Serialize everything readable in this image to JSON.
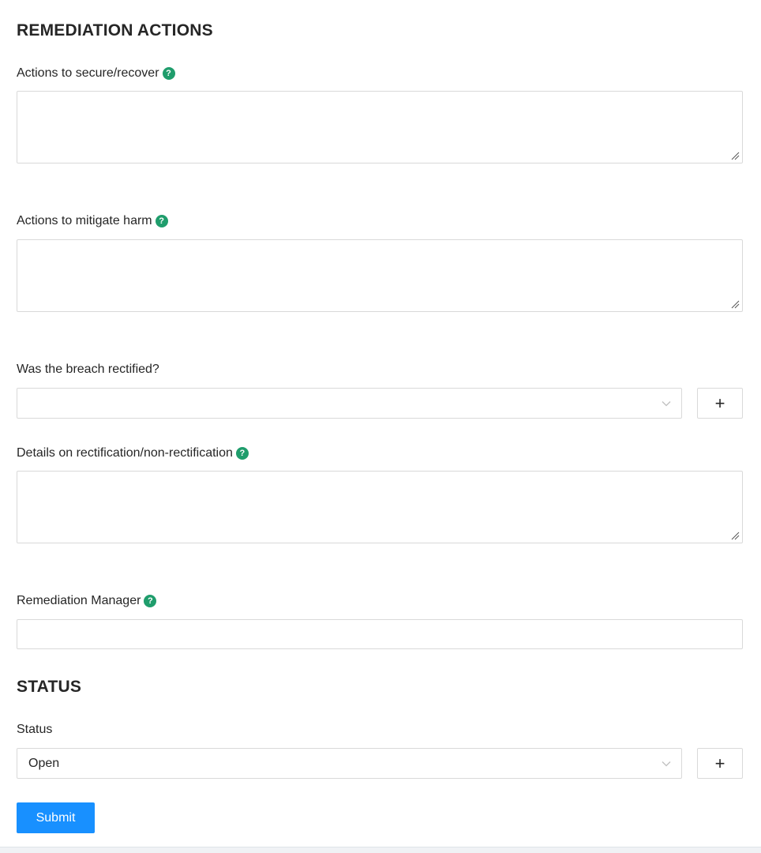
{
  "remediation": {
    "title": "REMEDIATION ACTIONS",
    "secure_label": "Actions to secure/recover",
    "secure_value": "",
    "mitigate_label": "Actions to mitigate harm",
    "mitigate_value": "",
    "rectified_label": "Was the breach rectified?",
    "rectified_value": "",
    "rectified_add": "+",
    "details_label": "Details on rectification/non-rectification",
    "details_value": "",
    "manager_label": "Remediation Manager",
    "manager_value": ""
  },
  "status": {
    "title": "STATUS",
    "status_label": "Status",
    "status_value": "Open",
    "status_add": "+"
  },
  "actions": {
    "submit_label": "Submit"
  },
  "icons": {
    "help": "question-icon",
    "chevron": "chevron-down-icon",
    "resize": "resize-grip-icon",
    "add": "plus-icon"
  },
  "colors": {
    "help_icon": "#1f9d6c",
    "primary": "#1890ff",
    "border": "#d9d9d9",
    "text": "#262626"
  }
}
